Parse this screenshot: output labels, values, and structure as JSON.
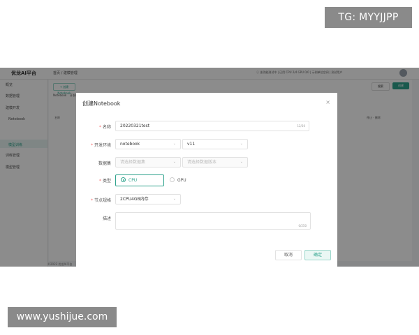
{
  "watermarks": {
    "tg": "TG: MYYJJPP",
    "site": "www.yushijue.com"
  },
  "app": {
    "brand": "优龙AI平台",
    "breadcrumb": "首页 / 建模管理",
    "topinfo": "ⓘ 该功能测试中 | 已用 CPU 2/4 GPU 0/0 | 示例单位空间 | 测试用户",
    "sidebar": [
      "概览",
      "数据管理",
      "建模开发",
      "Notebook",
      "模型训练",
      "训练管理",
      "模型管理"
    ],
    "new_button": "+ 创建Notebook",
    "tabs": [
      "Notebook",
      "开发环境"
    ],
    "search_label": "搜索",
    "create_label": "创建",
    "row_texts": [
      "名称",
      "运行中",
      "停止 · 删除"
    ],
    "footer": "©2022 优龙AI平台"
  },
  "dialog": {
    "title": "创建Notebook",
    "close_icon": "×",
    "fields": {
      "name": {
        "label": "名称",
        "value": "20220321test",
        "counter": "12/30"
      },
      "env": {
        "label": "开发环境",
        "value1": "notebook",
        "value2": "v11"
      },
      "dataset": {
        "label": "数据集",
        "placeholder1": "请选择数据集",
        "placeholder2": "请选择数据版本"
      },
      "type": {
        "label": "类型",
        "cpu": "CPU",
        "gpu": "GPU",
        "selected": "CPU"
      },
      "spec": {
        "label": "节点规格",
        "value": "2CPU4GB内存"
      },
      "desc": {
        "label": "描述",
        "counter": "0/250"
      }
    },
    "cancel_label": "取消",
    "ok_label": "确定"
  },
  "colors": {
    "accent": "#2fa38d",
    "required": "#f56c6c"
  },
  "icons": {
    "close": "close-icon",
    "caret": "chevron-down-icon",
    "avatar": "user-avatar"
  }
}
